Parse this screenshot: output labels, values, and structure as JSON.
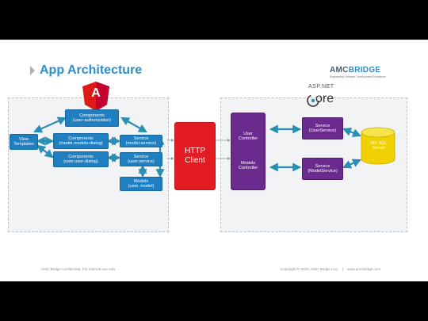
{
  "title": "App Architecture",
  "logo": {
    "word_a": "AMC",
    "word_b": "BRIDGE",
    "tagline": "Engineering Software Development Excellence"
  },
  "angular": {
    "badge_letter": "A"
  },
  "aspnet": {
    "label": "ASP.NET",
    "core_word": "ore"
  },
  "nodes": {
    "components_user_auth": "Components\n(user-authorization)",
    "view_templates": "View\nTemplates",
    "components_models_dialog": "Components\n(model.models-dialog)",
    "components_user_dialog": "Components\n(user.user-dialog)",
    "service_model": "Service\n(model-service)",
    "service_user": "Service\n(user.service)",
    "models_user_model": "Models\n(user. model)",
    "http_client": "HTTP\nClient",
    "user_controller": "User\nController",
    "models_controller": "Models\nController",
    "service_user_service": "Service\n(UserService)",
    "service_model_service": "Service\n(ModelService)",
    "database": "MS SQL\nServer"
  },
  "footer": {
    "left": "AMC Bridge confidential. For internal use only",
    "copyright": "Copyright © 2020, AMC Bridge LLC",
    "separator": "|",
    "website": "www.amcbridge.com"
  },
  "colors": {
    "accent": "#2e8fc7",
    "angular_red": "#dd1b16",
    "http_red": "#e31c23",
    "purple": "#6a2a8e",
    "db_yellow": "#f1d000",
    "arrow_teal": "#2a8fb3"
  }
}
